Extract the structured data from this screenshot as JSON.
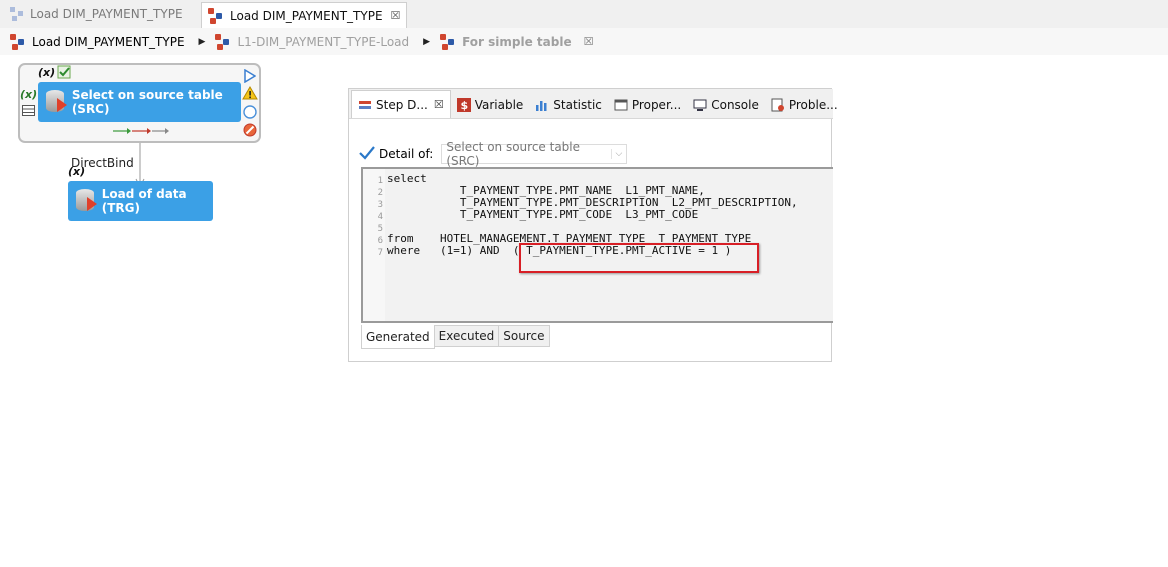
{
  "editor_tabs": [
    {
      "label": "Load DIM_PAYMENT_TYPE",
      "active": false
    },
    {
      "label": "Load DIM_PAYMENT_TYPE",
      "active": true,
      "close": "☒"
    }
  ],
  "breadcrumb": {
    "items": [
      {
        "label": "Load DIM_PAYMENT_TYPE"
      },
      {
        "label": "L1-DIM_PAYMENT_TYPE-Load"
      },
      {
        "label": "For simple table",
        "close": "☒"
      }
    ]
  },
  "diagram": {
    "xvar": "(x)",
    "source_node": {
      "label": "Select on source table (SRC)"
    },
    "link_label": "DirectBind",
    "target_node": {
      "label": "Load of data (TRG)"
    }
  },
  "view": {
    "tabs": [
      {
        "label": "Step D...",
        "icon": "step-icon",
        "close": "☒"
      },
      {
        "label": "Variable",
        "icon": "dollar-icon"
      },
      {
        "label": "Statistic",
        "icon": "bar-chart-icon"
      },
      {
        "label": "Proper...",
        "icon": "properties-icon"
      },
      {
        "label": "Console",
        "icon": "console-icon"
      },
      {
        "label": "Proble...",
        "icon": "problems-icon"
      }
    ],
    "detail_label": "Detail of:",
    "detail_value": "Select on source table (SRC)",
    "line_numbers": "1\n2\n3\n4\n5\n6\n7",
    "code": "select\n           T_PAYMENT_TYPE.PMT_NAME  L1_PMT_NAME,\n           T_PAYMENT_TYPE.PMT_DESCRIPTION  L2_PMT_DESCRIPTION,\n           T_PAYMENT_TYPE.PMT_CODE  L3_PMT_CODE\n\nfrom    HOTEL_MANAGEMENT.T_PAYMENT_TYPE  T_PAYMENT_TYPE\nwhere   (1=1) AND  ( T_PAYMENT_TYPE.PMT_ACTIVE = 1 )",
    "sub_tabs": [
      {
        "label": "Generated",
        "active": true
      },
      {
        "label": "Executed",
        "active": false
      },
      {
        "label": "Source",
        "active": false
      }
    ]
  }
}
